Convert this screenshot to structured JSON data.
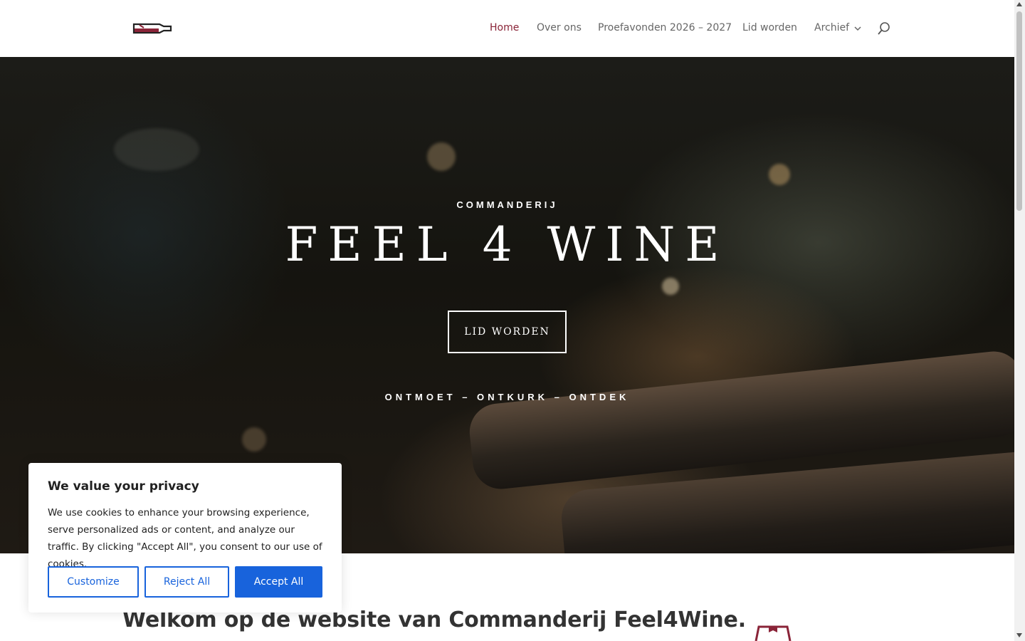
{
  "header": {
    "logo_icon": "wine-bottle-logo-icon",
    "nav": [
      {
        "label": "Home",
        "active": true
      },
      {
        "label": "Over ons",
        "active": false
      },
      {
        "label": "Proefavonden 2026 – 2027",
        "active": false
      },
      {
        "label": "Lid worden",
        "active": false
      },
      {
        "label": "Archief",
        "active": false,
        "has_dropdown": true
      }
    ],
    "search_icon": "search-icon",
    "active_color": "#8a2438"
  },
  "hero": {
    "kicker": "COMMANDERIJ",
    "title": "FEEL 4 WINE",
    "button": "LID WORDEN",
    "tagline": "ONTMOET – ONTKURK – ONTDEK"
  },
  "main": {
    "welcome": "Welkom op de website van Commanderij Feel4Wine."
  },
  "cookie": {
    "title": "We value your privacy",
    "text": "We use cookies to enhance your browsing experience, serve personalized ads or content, and analyze our traffic. By clicking \"Accept All\", you consent to our use of cookies.",
    "customize": "Customize",
    "reject": "Reject All",
    "accept": "Accept All",
    "button_color": "#1863dc"
  }
}
